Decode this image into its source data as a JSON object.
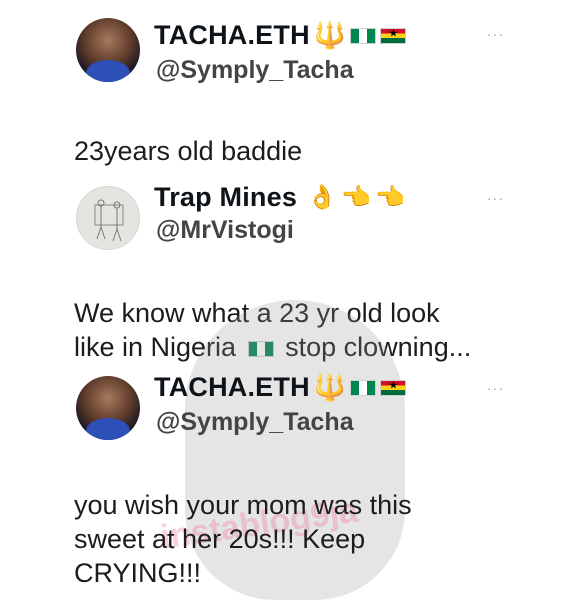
{
  "tweets": [
    {
      "name": "TACHA.ETH",
      "handle": "@Symply_Tacha",
      "text_lines": [
        "23years old baddie"
      ],
      "more": "···"
    },
    {
      "name": "Trap Mines",
      "handle": "@MrVistogi",
      "text_lines": [
        "We know what a 23 yr old look",
        "like in Nigeria",
        "stop clowning..."
      ],
      "more": "···"
    },
    {
      "name": "TACHA.ETH",
      "handle": "@Symply_Tacha",
      "text_lines": [
        "you wish your mom was this",
        "sweet at her 20s!!! Keep",
        "CRYING!!!"
      ],
      "more": "···"
    }
  ],
  "emoji": {
    "trident": "🔱",
    "hand": "👌",
    "point_left": "👈"
  },
  "watermark": "instablog9ja",
  "colors": {
    "nigeria_green": "#008751",
    "ghana_red": "#ce1126",
    "ghana_yellow": "#fcd116",
    "ghana_green": "#006b3f"
  }
}
